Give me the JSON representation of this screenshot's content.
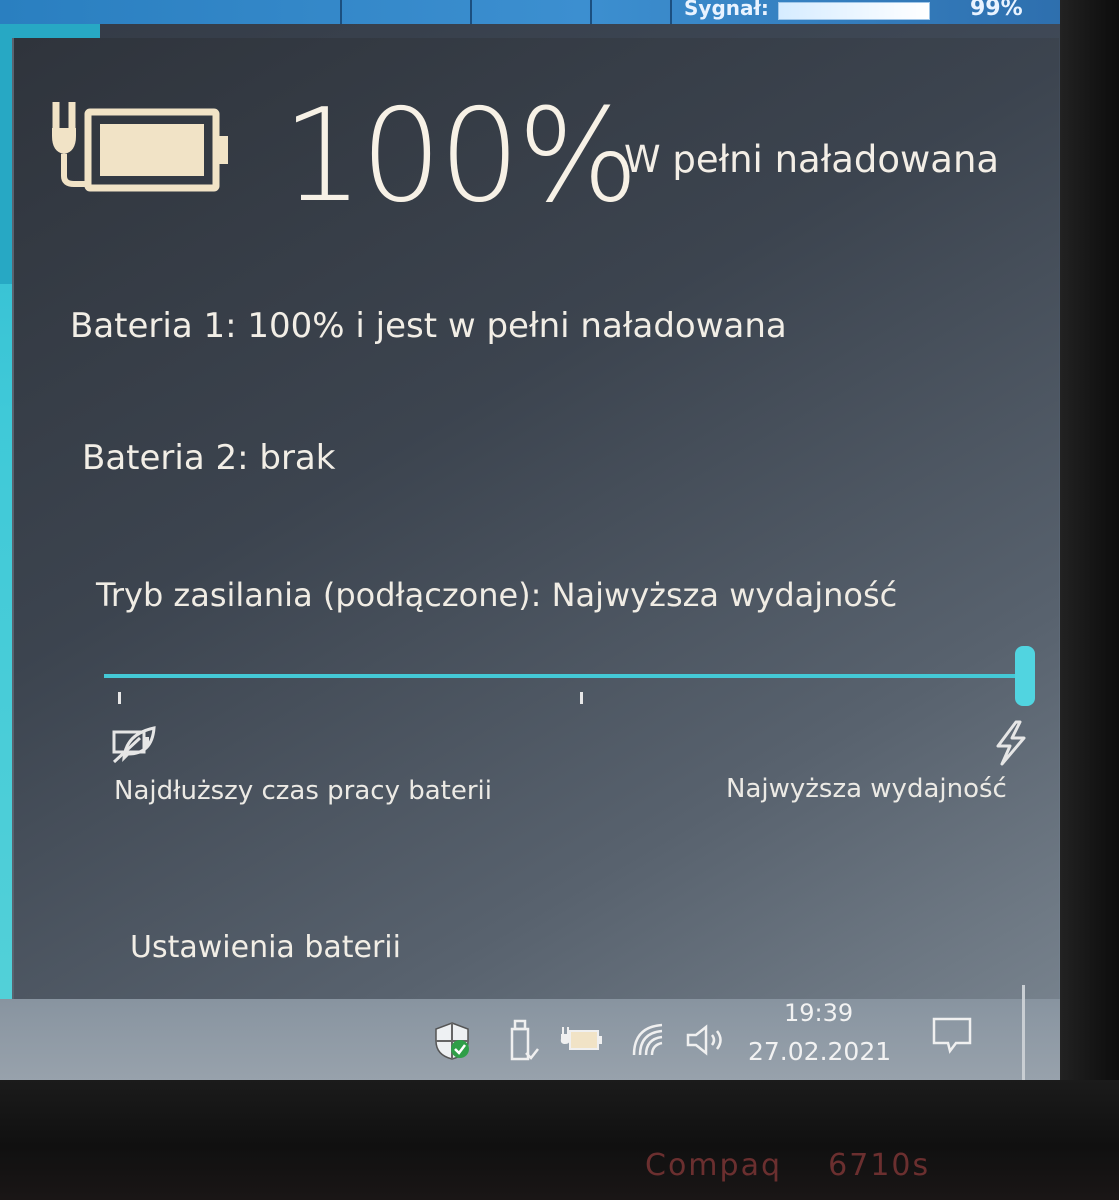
{
  "top_strip": {
    "signal_label": "Sygnał:",
    "signal_value": "99%"
  },
  "battery": {
    "percent": "100%",
    "status": "W pełni naładowana",
    "battery1": "Bateria 1: 100% i jest w pełni naładowana",
    "battery2": "Bateria 2: brak",
    "icons": {
      "main": "battery-plugged-icon",
      "saver": "battery-saver-leaf-icon",
      "performance": "lightning-icon"
    }
  },
  "power_mode": {
    "title": "Tryb zasilania (podłączone): Najwyższa wydajność",
    "slider_level": 1.0,
    "min_label": "Najdłuższy czas pracy baterii",
    "max_label": "Najwyższa wydajność"
  },
  "settings_link": "Ustawienia baterii",
  "taskbar": {
    "tray_icons": [
      "defender-shield-icon",
      "usb-drive-icon",
      "battery-icon",
      "wifi-icon",
      "volume-icon"
    ],
    "time": "19:39",
    "date": "27.02.2021",
    "notification_icon": "action-center-icon"
  },
  "monitor": {
    "brand": "Compaq    6710s"
  },
  "colors": {
    "accent": "#44c9d6",
    "battery_fill": "#f1e3c6",
    "text": "#f2eee6",
    "brand_red": "#6b2f2f"
  }
}
